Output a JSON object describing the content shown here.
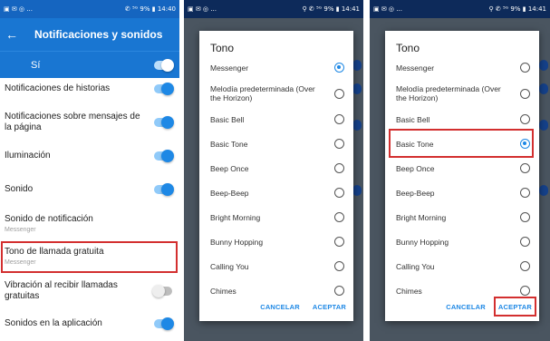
{
  "left_panel": {
    "status_bar": {
      "left_icons": "▣ ✉ ◎ ...",
      "right": "✆ ⁵ᴳ 9% ▮ 14:40"
    },
    "app_bar": {
      "back_icon": "←",
      "title": "Notificaciones y sonidos"
    },
    "master_toggle": {
      "label": "Sí",
      "state": "on"
    },
    "settings": [
      {
        "label": "Notificaciones de historias",
        "sub": "",
        "state": "on"
      },
      {
        "label": "Notificaciones sobre mensajes de la página",
        "sub": "",
        "state": "on"
      },
      {
        "label": "Iluminación",
        "sub": "",
        "state": "on"
      },
      {
        "label": "Sonido",
        "sub": "",
        "state": "on"
      },
      {
        "label": "Sonido de notificación",
        "sub": "Messenger",
        "state": "none"
      },
      {
        "label": "Tono de llamada gratuita",
        "sub": "Messenger",
        "state": "none"
      },
      {
        "label": "Vibración al recibir llamadas gratuitas",
        "sub": "",
        "state": "off"
      },
      {
        "label": "Sonidos en la aplicación",
        "sub": "",
        "state": "on"
      }
    ]
  },
  "dialog_before": {
    "status_bar": {
      "left_icons": "▣ ✉ ◎ ...",
      "right": "⚲ ✆ ⁵ᴳ 9% ▮ 14:41"
    },
    "title": "Tono",
    "options": [
      {
        "label": "Messenger",
        "selected": true
      },
      {
        "label": "Melodía predeterminada (Over the Horizon)",
        "selected": false
      },
      {
        "label": "Basic Bell",
        "selected": false
      },
      {
        "label": "Basic Tone",
        "selected": false
      },
      {
        "label": "Beep Once",
        "selected": false
      },
      {
        "label": "Beep-Beep",
        "selected": false
      },
      {
        "label": "Bright Morning",
        "selected": false
      },
      {
        "label": "Bunny Hopping",
        "selected": false
      },
      {
        "label": "Calling You",
        "selected": false
      },
      {
        "label": "Chimes",
        "selected": false
      }
    ],
    "cancel_label": "CANCELAR",
    "accept_label": "ACEPTAR"
  },
  "dialog_after": {
    "status_bar": {
      "left_icons": "▣ ✉ ◎ ...",
      "right": "⚲ ✆ ⁵ᴳ 9% ▮ 14:41"
    },
    "title": "Tono",
    "options": [
      {
        "label": "Messenger",
        "selected": false
      },
      {
        "label": "Melodía predeterminada (Over the Horizon)",
        "selected": false
      },
      {
        "label": "Basic Bell",
        "selected": false
      },
      {
        "label": "Basic Tone",
        "selected": true
      },
      {
        "label": "Beep Once",
        "selected": false
      },
      {
        "label": "Beep-Beep",
        "selected": false
      },
      {
        "label": "Bright Morning",
        "selected": false
      },
      {
        "label": "Bunny Hopping",
        "selected": false
      },
      {
        "label": "Calling You",
        "selected": false
      },
      {
        "label": "Chimes",
        "selected": false
      }
    ],
    "cancel_label": "CANCELAR",
    "accept_label": "ACEPTAR"
  },
  "colors": {
    "primary": "#1976d2",
    "accent": "#1e88e5",
    "highlight": "#d32f2f",
    "dim_overlay": "#4a5560"
  }
}
